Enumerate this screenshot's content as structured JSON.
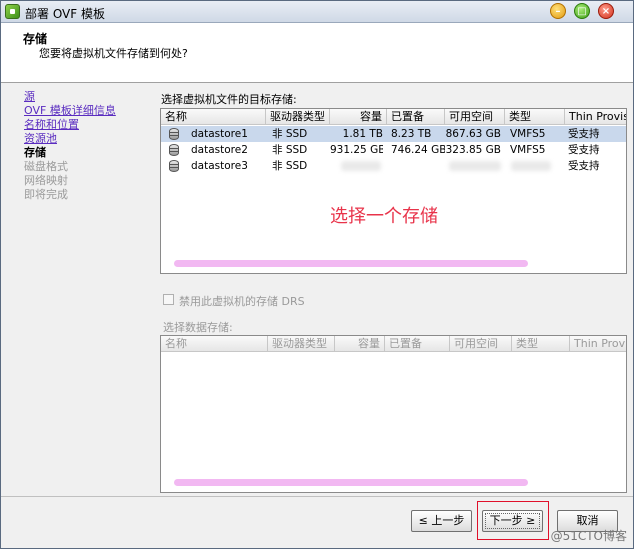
{
  "window": {
    "title": "部署 OVF 模板"
  },
  "header": {
    "title": "存储",
    "subtitle": "您要将虚拟机文件存储到何处?"
  },
  "steps": [
    {
      "label": "源",
      "state": "link"
    },
    {
      "label": "OVF 模板详细信息",
      "state": "link"
    },
    {
      "label": "名称和位置",
      "state": "link"
    },
    {
      "label": "资源池",
      "state": "link"
    },
    {
      "label": "存储",
      "state": "current"
    },
    {
      "label": "磁盘格式",
      "state": "disabled"
    },
    {
      "label": "网络映射",
      "state": "disabled"
    },
    {
      "label": "即将完成",
      "state": "disabled"
    }
  ],
  "main": {
    "section_label": "选择虚拟机文件的目标存储:",
    "columns": [
      "名称",
      "驱动器类型",
      "容量",
      "已置备",
      "可用空间",
      "类型",
      "Thin Provisi"
    ],
    "rows": [
      {
        "name": "datastore1",
        "drive": "非 SSD",
        "capacity": "1.81 TB",
        "provisioned": "8.23 TB",
        "free": "867.63 GB",
        "type": "VMFS5",
        "thin": "受支持"
      },
      {
        "name": "datastore2",
        "drive": "非 SSD",
        "capacity": "931.25 GB",
        "provisioned": "746.24 GB",
        "free": "323.85 GB",
        "type": "VMFS5",
        "thin": "受支持"
      },
      {
        "name": "datastore3",
        "drive": "非 SSD",
        "capacity": "",
        "provisioned": "",
        "free": "",
        "type": "",
        "thin": "受支持"
      }
    ],
    "annotation": "选择一个存储",
    "checkbox_label": "禁用此虚拟机的存储 DRS",
    "select_label": "选择数据存储:",
    "columns2": [
      "名称",
      "驱动器类型",
      "容量",
      "已置备",
      "可用空间",
      "类型",
      "Thin Provi"
    ]
  },
  "footer": {
    "prev": "≤ 上一步",
    "next": "下一步 ≥",
    "cancel": "取消"
  },
  "watermark": "@51CTO博客"
}
